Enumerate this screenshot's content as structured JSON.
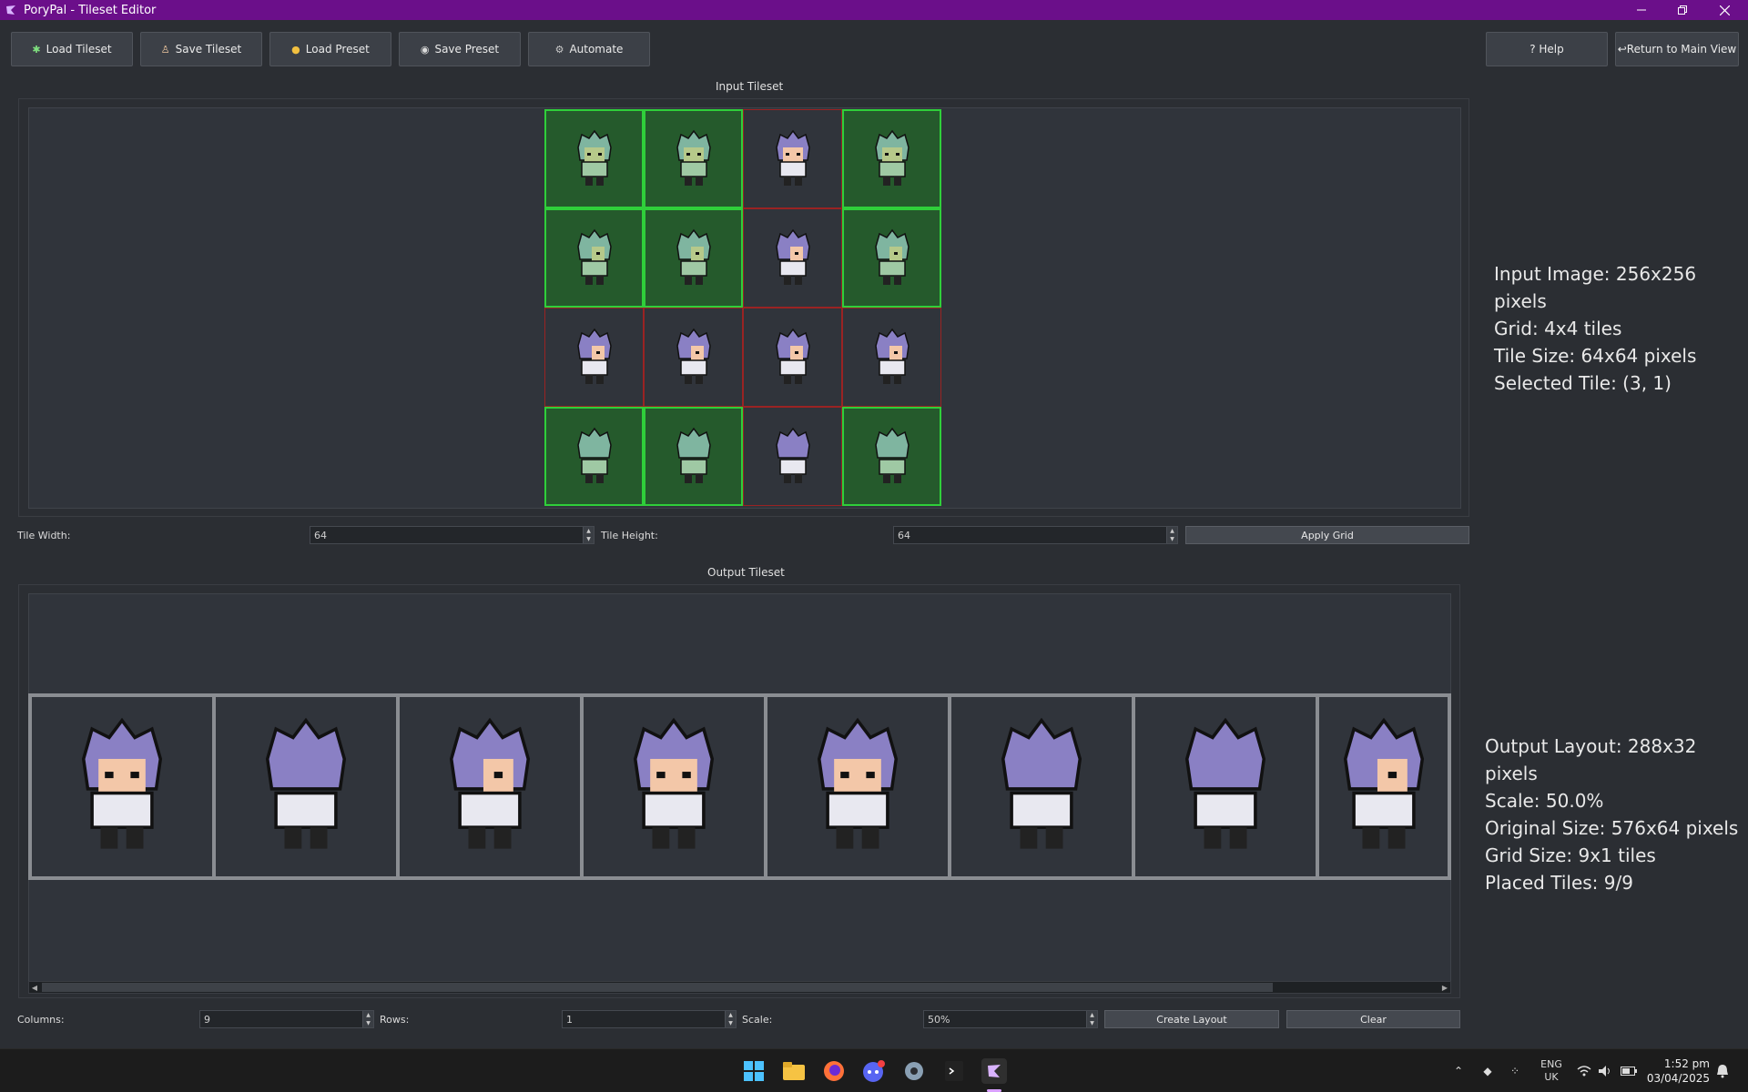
{
  "window": {
    "title": "PoryPal - Tileset Editor"
  },
  "toolbar": {
    "load_tileset": "Load Tileset",
    "save_tileset": "Save Tileset",
    "load_preset": "Load Preset",
    "save_preset": "Save Preset",
    "automate": "Automate",
    "help": "? Help",
    "return_main": "↩Return to Main View"
  },
  "input": {
    "label": "Input Tileset",
    "info": [
      "Input Image: 256x256 pixels",
      "Grid: 4x4 tiles",
      "Tile Size: 64x64 pixels",
      "Selected Tile: (3, 1)"
    ],
    "grid": [
      [
        true,
        true,
        false,
        true
      ],
      [
        true,
        true,
        false,
        true
      ],
      [
        false,
        false,
        false,
        false
      ],
      [
        true,
        true,
        false,
        true
      ]
    ],
    "tile_width_label": "Tile Width:",
    "tile_width_value": "64",
    "tile_height_label": "Tile Height:",
    "tile_height_value": "64",
    "apply_grid": "Apply Grid"
  },
  "output": {
    "label": "Output Tileset",
    "info": [
      "Output Layout: 288x32 pixels",
      "Scale: 50.0%",
      "Original Size: 576x64 pixels",
      "Grid Size: 9x1 tiles",
      "Placed Tiles: 9/9"
    ],
    "columns_label": "Columns:",
    "columns_value": "9",
    "rows_label": "Rows:",
    "rows_value": "1",
    "scale_label": "Scale:",
    "scale_value": "50%",
    "create_layout": "Create Layout",
    "clear": "Clear"
  },
  "taskbar": {
    "lang_top": "ENG",
    "lang_bottom": "UK",
    "time": "1:52 pm",
    "date": "03/04/2025"
  },
  "colors": {
    "titlebar": "#6b0f8a",
    "selected_tile_border": "#2fcf3a",
    "unselected_tile_border": "#9a2323"
  }
}
